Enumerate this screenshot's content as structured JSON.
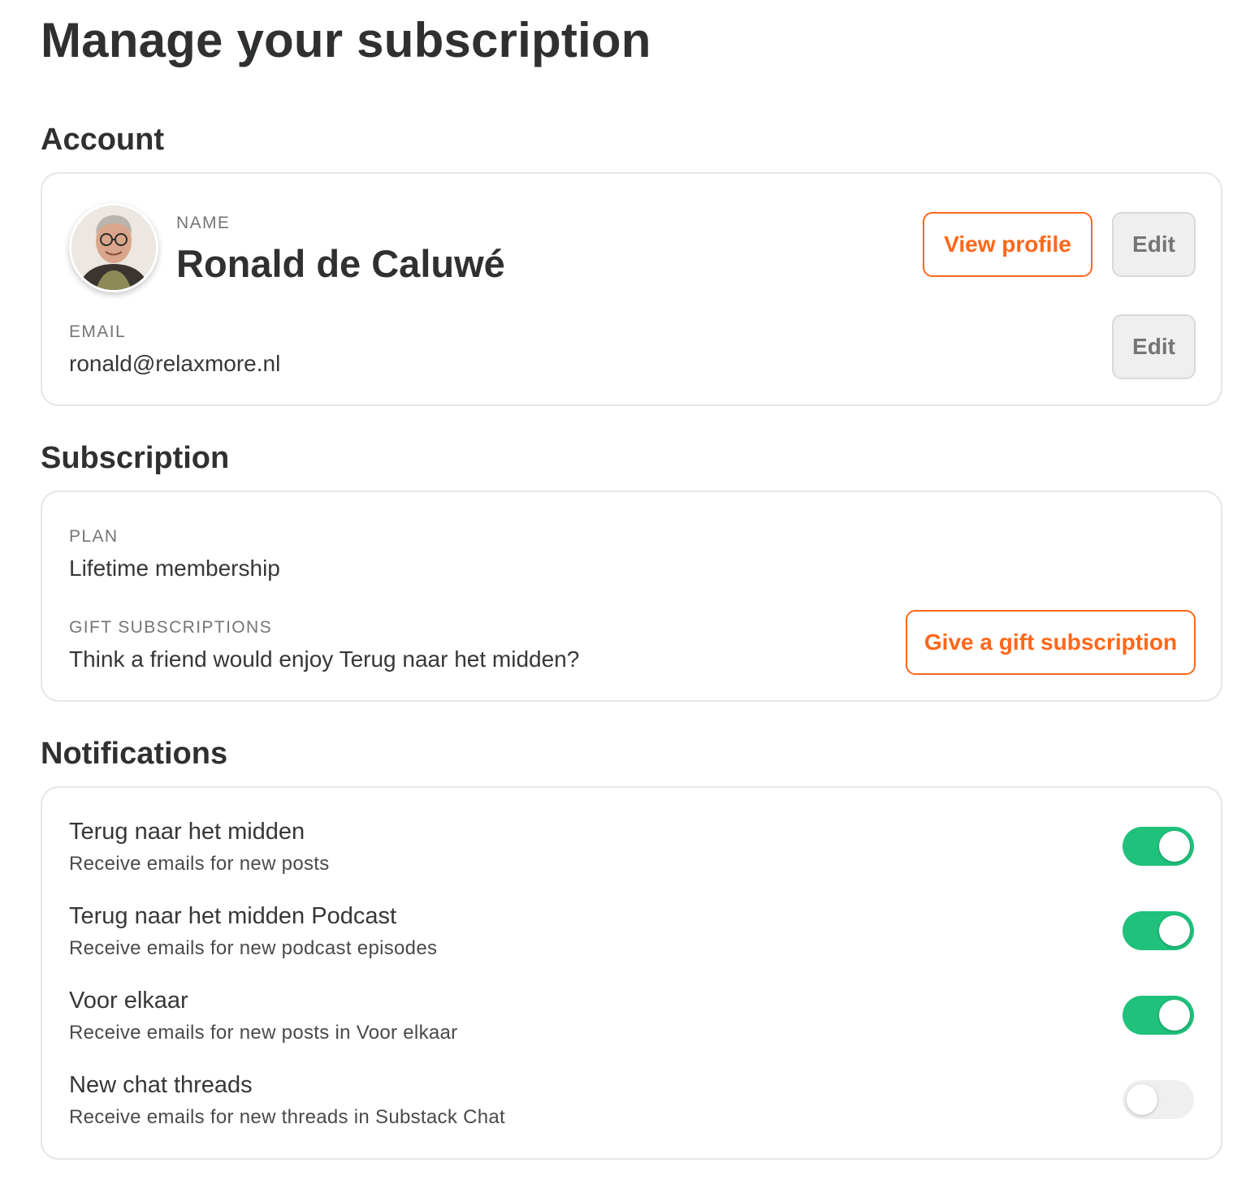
{
  "page_title": "Manage your subscription",
  "account": {
    "section_title": "Account",
    "name_label": "NAME",
    "name_value": "Ronald de Caluwé",
    "view_profile_label": "View profile",
    "edit_label": "Edit",
    "email_label": "EMAIL",
    "email_value": "ronald@relaxmore.nl",
    "email_edit_label": "Edit"
  },
  "subscription": {
    "section_title": "Subscription",
    "plan_label": "PLAN",
    "plan_value": "Lifetime membership",
    "gift_label": "GIFT SUBSCRIPTIONS",
    "gift_text": "Think a friend would enjoy Terug naar het midden?",
    "gift_button_label": "Give a gift subscription"
  },
  "notifications": {
    "section_title": "Notifications",
    "items": [
      {
        "title": "Terug naar het midden",
        "subtitle": "Receive emails for new posts",
        "enabled": true
      },
      {
        "title": "Terug naar het midden Podcast",
        "subtitle": "Receive emails for new podcast episodes",
        "enabled": true
      },
      {
        "title": "Voor elkaar",
        "subtitle": "Receive emails for new posts in Voor elkaar",
        "enabled": true
      },
      {
        "title": "New chat threads",
        "subtitle": "Receive emails for new threads in Substack Chat",
        "enabled": false
      }
    ]
  },
  "colors": {
    "accent": "#ff6719",
    "toggle_on": "#1fc17b",
    "toggle_off": "#efefef"
  }
}
